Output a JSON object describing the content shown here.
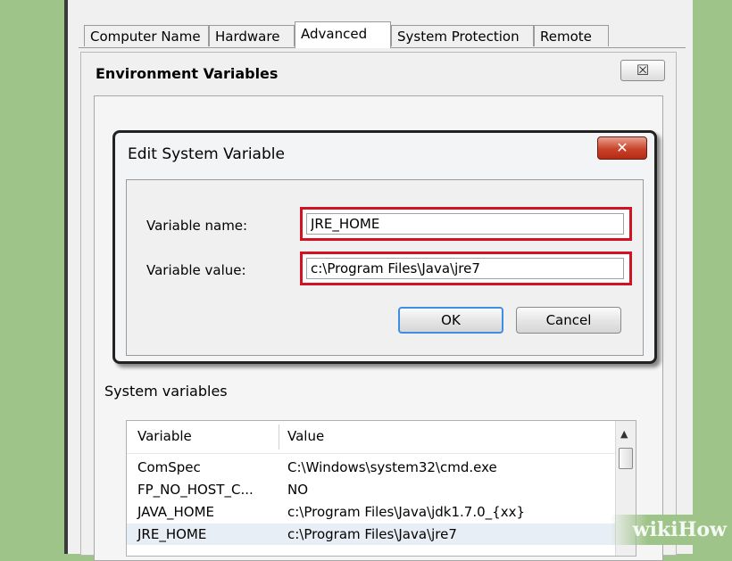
{
  "tabs": [
    "Computer Name",
    "Hardware",
    "Advanced",
    "System Protection",
    "Remote"
  ],
  "env_window": {
    "title": "Environment Variables",
    "close_glyph": "☒"
  },
  "dialog": {
    "title": "Edit System Variable",
    "close_glyph": "✕",
    "name_label": "Variable name:",
    "name_value": "JRE_HOME",
    "value_label": "Variable value:",
    "value_value": "c:\\Program Files\\Java\\jre7",
    "ok_label": "OK",
    "cancel_label": "Cancel"
  },
  "system_variables": {
    "label": "System variables",
    "columns": [
      "Variable",
      "Value"
    ],
    "rows": [
      {
        "variable": "ComSpec",
        "value": "C:\\Windows\\system32\\cmd.exe"
      },
      {
        "variable": "FP_NO_HOST_C...",
        "value": "NO"
      },
      {
        "variable": "JAVA_HOME",
        "value": "c:\\Program Files\\Java\\jdk1.7.0_{xx}"
      },
      {
        "variable": "JRE_HOME",
        "value": "c:\\Program Files\\Java\\jre7"
      }
    ],
    "selected_row": 3
  },
  "watermark": {
    "part1": "wiki",
    "part2": "How"
  },
  "colors": {
    "highlight": "#d01222",
    "background": "#9fc48a",
    "ok_focus": "#3f8ee6"
  }
}
